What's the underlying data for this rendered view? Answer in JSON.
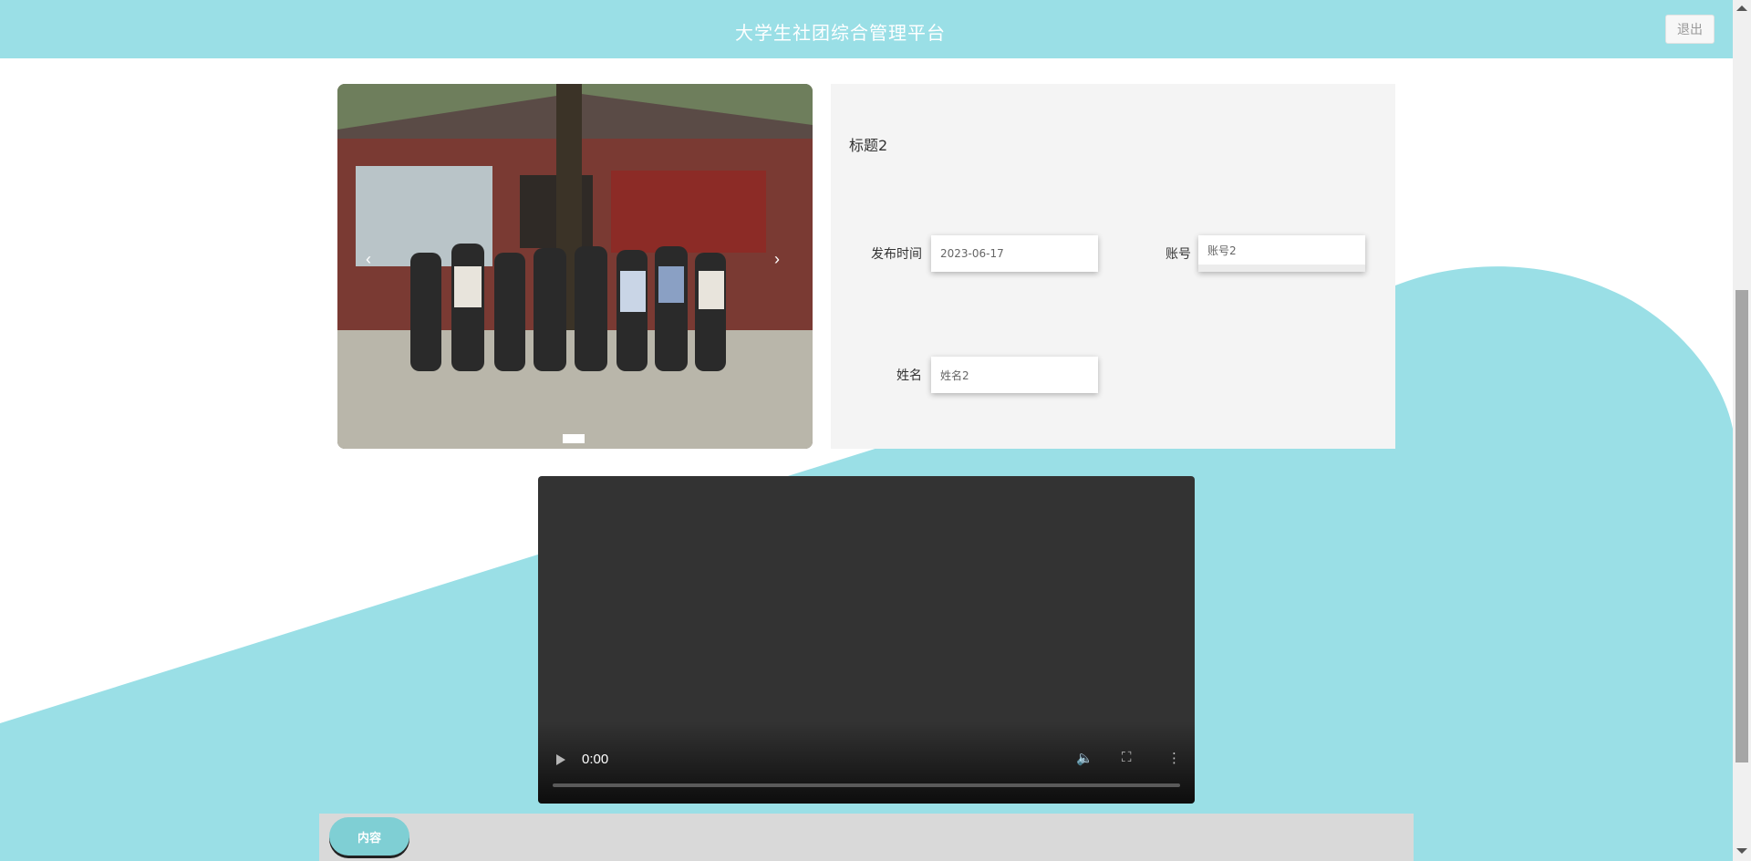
{
  "header": {
    "title": "大学生社团综合管理平台",
    "logout_label": "退出"
  },
  "carousel": {
    "prev_icon": "‹",
    "next_icon": "›"
  },
  "detail": {
    "heading": "标题2",
    "fields": [
      {
        "label": "发布时间",
        "value": "2023-06-17"
      },
      {
        "label": "账号",
        "value": "账号2"
      },
      {
        "label": "姓名",
        "value": "姓名2"
      }
    ]
  },
  "video": {
    "time": "0:00"
  },
  "content": {
    "tab_label": "内容"
  },
  "colors": {
    "accent": "#9adfe6",
    "tab": "#7fcfd4"
  }
}
